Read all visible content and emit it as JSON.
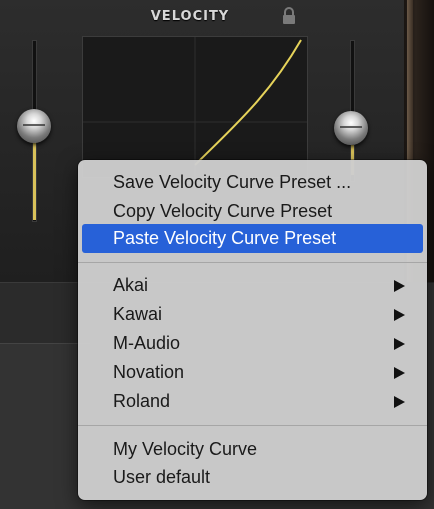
{
  "header": {
    "title": "VELOCITY"
  },
  "icons": {
    "lock": "lock-icon",
    "submenu_arrow": "chevron-right-icon"
  },
  "colors": {
    "curve": "#e6d35a",
    "highlight": "#2761d8",
    "menu_bg": "#cdcdcd"
  },
  "menu": {
    "items": [
      {
        "label": "Save Velocity Curve Preset ..."
      },
      {
        "label": "Copy Velocity Curve Preset"
      },
      {
        "label": "Paste Velocity Curve Preset",
        "highlighted": true
      }
    ],
    "manufacturers": [
      {
        "label": "Akai",
        "submenu": true
      },
      {
        "label": "Kawai",
        "submenu": true
      },
      {
        "label": "M-Audio",
        "submenu": true
      },
      {
        "label": "Novation",
        "submenu": true
      },
      {
        "label": "Roland",
        "submenu": true
      }
    ],
    "presets": [
      {
        "label": "My Velocity Curve"
      },
      {
        "label": "User default"
      }
    ]
  }
}
